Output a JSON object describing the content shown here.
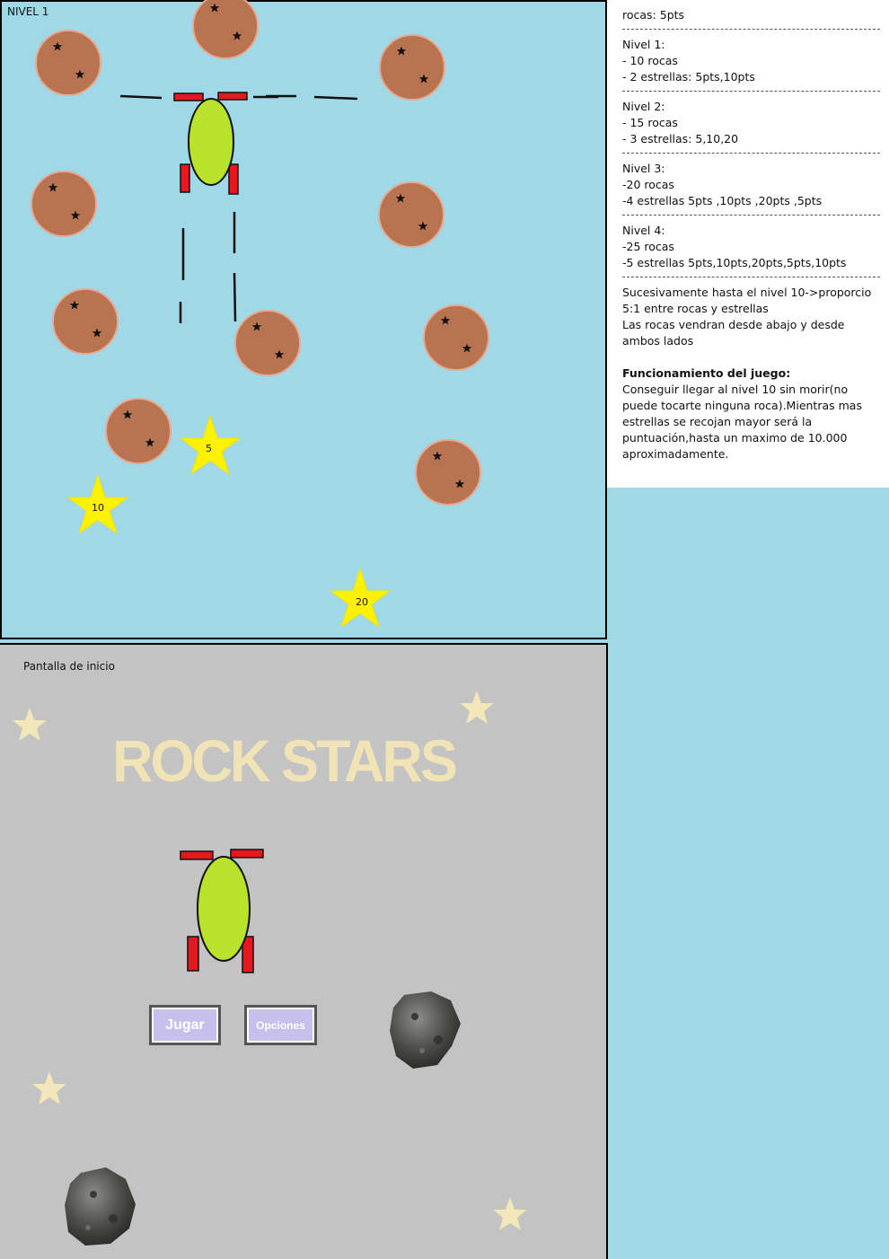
{
  "level_screen": {
    "title": "NIVEL 1",
    "star_values": [
      "5",
      "10",
      "20"
    ]
  },
  "start_screen": {
    "title": "Pantalla de inicio",
    "game_title": "ROCK STARS",
    "play_button": "Jugar",
    "options_button": "Opciones"
  },
  "notes": {
    "rock_points": "rocas: 5pts",
    "levels": [
      {
        "title": "Nivel 1:",
        "lines": [
          "- 10 rocas",
          "- 2 estrellas: 5pts,10pts"
        ]
      },
      {
        "title": "Nivel 2:",
        "lines": [
          "- 15 rocas",
          "- 3 estrellas: 5,10,20"
        ]
      },
      {
        "title": "Nivel 3:",
        "lines": [
          "-20 rocas",
          "-4 estrellas 5pts ,10pts ,20pts ,5pts"
        ]
      },
      {
        "title": "Nivel 4:",
        "lines": [
          "-25 rocas",
          "-5 estrellas 5pts,10pts,20pts,5pts,10pts"
        ]
      }
    ],
    "progression": "Sucesivamente hasta el nivel 10->proporcio 5:1 entre rocas y estrellas\nLas rocas vendran desde abajo y desde ambos lados",
    "gameplay_title": "Funcionamiento del juego:",
    "gameplay_text": "Conseguir llegar al nivel 10 sin morir(no puede tocarte ninguna roca).Mientras mas estrellas se recojan mayor será la puntuación,hasta un maximo de 10.000 aproximadamente."
  },
  "colors": {
    "sky": "#9fd9e8",
    "rock": "#b87350",
    "ship_body": "#b8e32a",
    "ship_fin": "#e8171e",
    "star": "#fff200",
    "menu_star": "#f3e6b8",
    "menu_bg": "#c3c3c3"
  }
}
